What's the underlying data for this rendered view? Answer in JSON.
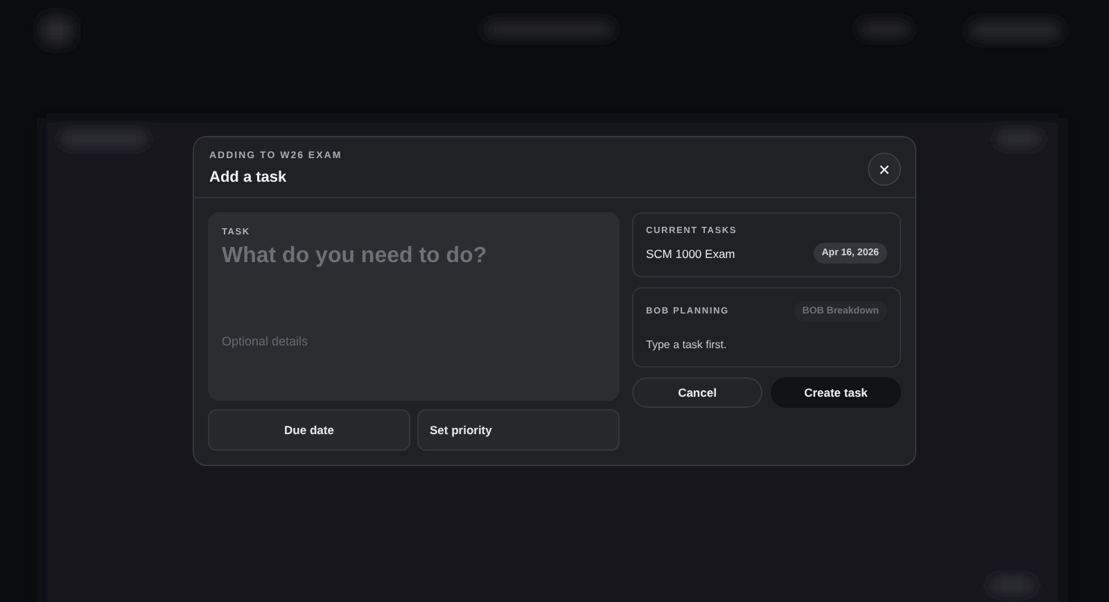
{
  "modal": {
    "eyebrow": "ADDING TO W26 EXAM",
    "title": "Add a task",
    "close": "×",
    "task": {
      "label": "TASK",
      "placeholder": "What do you need to do?",
      "details_placeholder": "Optional details"
    },
    "options": [
      "Due date",
      "Set priority"
    ],
    "current_tasks": {
      "label": "CURRENT TASKS",
      "items": [
        {
          "name": "SCM 1000 Exam",
          "date": "Apr 16, 2026"
        }
      ]
    },
    "planning": {
      "label": "BOB PLANNING",
      "action": "BOB Breakdown",
      "action_disabled": true,
      "message": "Type a task first."
    },
    "buttons": [
      {
        "label": "Cancel",
        "kind": "secondary"
      },
      {
        "label": "Create task",
        "kind": "primary"
      }
    ]
  }
}
